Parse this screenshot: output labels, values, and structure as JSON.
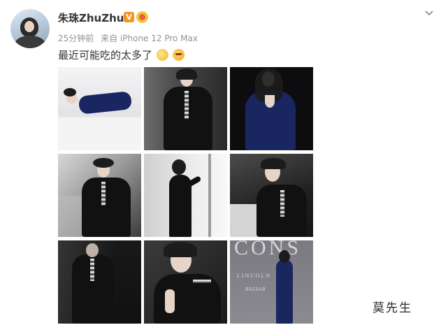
{
  "post": {
    "author": "朱珠ZhuZhu",
    "time": "25分钟前",
    "source": "来自 iPhone 12 Pro Max",
    "text": "最近可能吃的太多了",
    "badges": {
      "verified_label": "V"
    },
    "emojis": [
      "doge-laugh-emoji",
      "sunglasses-emoji"
    ]
  },
  "photos": [
    {
      "index": 1,
      "tone": "bright"
    },
    {
      "index": 2,
      "tone": "grayscale"
    },
    {
      "index": 3,
      "tone": "dark-blue"
    },
    {
      "index": 4,
      "tone": "grayscale"
    },
    {
      "index": 5,
      "tone": "light"
    },
    {
      "index": 6,
      "tone": "grayscale"
    },
    {
      "index": 7,
      "tone": "dark"
    },
    {
      "index": 8,
      "tone": "grayscale"
    },
    {
      "index": 9,
      "tone": "gray"
    }
  ],
  "photo9_text": {
    "line1": "CONS",
    "line2": "LINCOLN",
    "line3": "BAZAAR"
  },
  "watermark": "莫先生",
  "colors": {
    "username": "#333333",
    "meta": "#939393",
    "verified": "#f7941d"
  }
}
